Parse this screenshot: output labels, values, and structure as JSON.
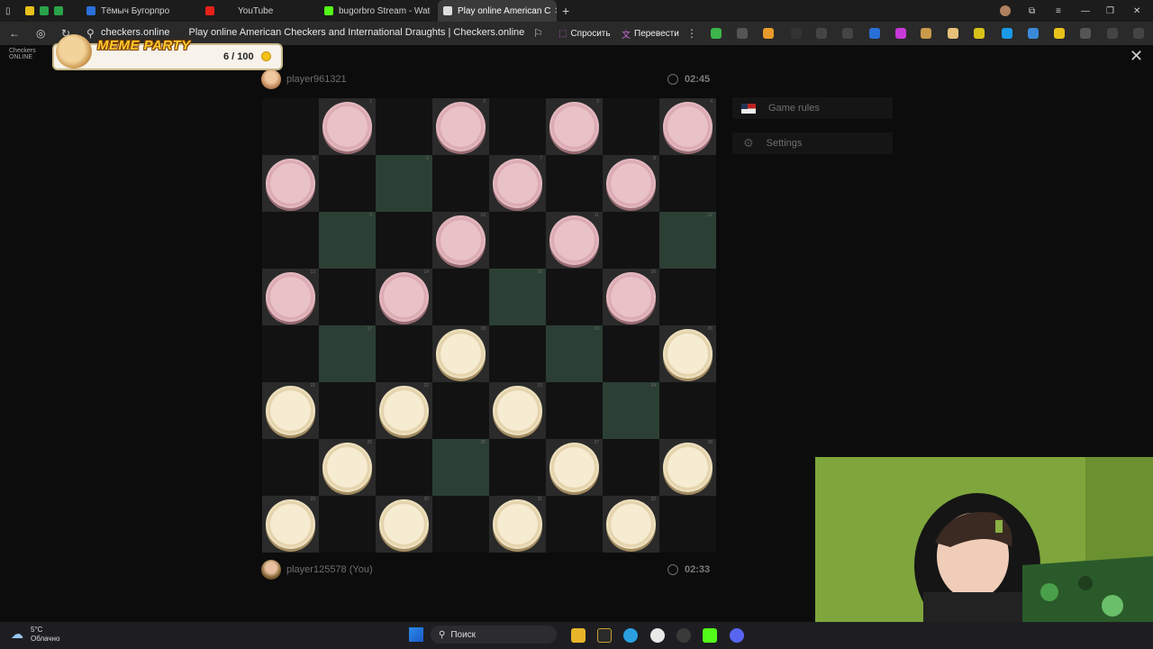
{
  "browser": {
    "tabs": [
      {
        "label": "Тёмыч Бугорпро",
        "active": false
      },
      {
        "label": "YouTube",
        "active": false
      },
      {
        "label": "bugorbro Stream - Watch",
        "active": false
      },
      {
        "label": "Play online American C",
        "active": true
      }
    ],
    "url": "checkers.online",
    "page_title": "Play online American Checkers and International Draughts | Checkers.online",
    "ask_label": "Спросить",
    "translate_label": "Перевести"
  },
  "meme_party": {
    "title": "MEME PARTY",
    "score": "6 / 100"
  },
  "site": {
    "logo_line1": "Checkers",
    "logo_line2": "ONLINE"
  },
  "opponent": {
    "name": "player961321",
    "timer": "02:45"
  },
  "player": {
    "name": "player125578 (You)",
    "timer": "02:33"
  },
  "menu": {
    "game_rules": "Game rules",
    "settings": "Settings"
  },
  "board": {
    "highlighted_squares": [
      6,
      9,
      12,
      15,
      17,
      19,
      24,
      26
    ],
    "red_squares": [
      1,
      2,
      3,
      4,
      5,
      7,
      8,
      10,
      11,
      13,
      14,
      16
    ],
    "white_squares": [
      18,
      20,
      21,
      22,
      23,
      25,
      27,
      28,
      29,
      30,
      31,
      32
    ]
  },
  "taskbar": {
    "weather_temp": "5°C",
    "weather_desc": "Облачно",
    "search": "Поиск"
  },
  "colors": {
    "board_dark": "#2a2a2a",
    "board_highlight": "#2c3f34",
    "red_piece": "#e9c2c8",
    "white_piece": "#f6ecd2"
  }
}
